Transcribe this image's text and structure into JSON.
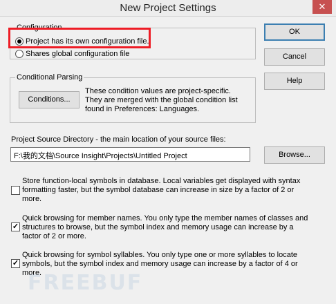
{
  "window": {
    "title": "New Project Settings",
    "close_glyph": "✕"
  },
  "configuration": {
    "group_label": "Configuration",
    "options": [
      {
        "label": "Project has its own configuration file.",
        "selected": true
      },
      {
        "label": "Shares global configuration file",
        "selected": false
      }
    ]
  },
  "conditional_parsing": {
    "group_label": "Conditional Parsing",
    "button_label": "Conditions...",
    "description": [
      "These condition values are project-specific.",
      "They are merged with the global condition list",
      "found in Preferences: Languages."
    ]
  },
  "source_dir": {
    "label": "Project Source Directory - the main location of your source files:",
    "value": "F:\\我的文档\\Source Insight\\Projects\\Untitled Project",
    "browse_label": "Browse..."
  },
  "side_buttons": {
    "ok_label": "OK",
    "cancel_label": "Cancel",
    "help_label": "Help"
  },
  "options": [
    {
      "checked": false,
      "lines": [
        "Store function-local symbols in database.  Local variables get displayed with syntax",
        "formatting faster, but the symbol database can increase in size by a factor of 2 or",
        "more."
      ]
    },
    {
      "checked": true,
      "lines": [
        "Quick browsing for member names.  You only type the member names of classes and",
        "structures to browse, but the symbol index and memory usage can increase by a",
        "factor of 2 or more."
      ]
    },
    {
      "checked": true,
      "lines": [
        "Quick browsing for symbol syllables.  You only type one or more syllables to locate",
        "symbols, but the symbol index and memory usage can increase by a factor of 4 or",
        "more."
      ]
    }
  ],
  "watermark": "FREEBUF",
  "colors": {
    "highlight": "#ee1c25",
    "dialog_bg": "#f0f0f0"
  }
}
